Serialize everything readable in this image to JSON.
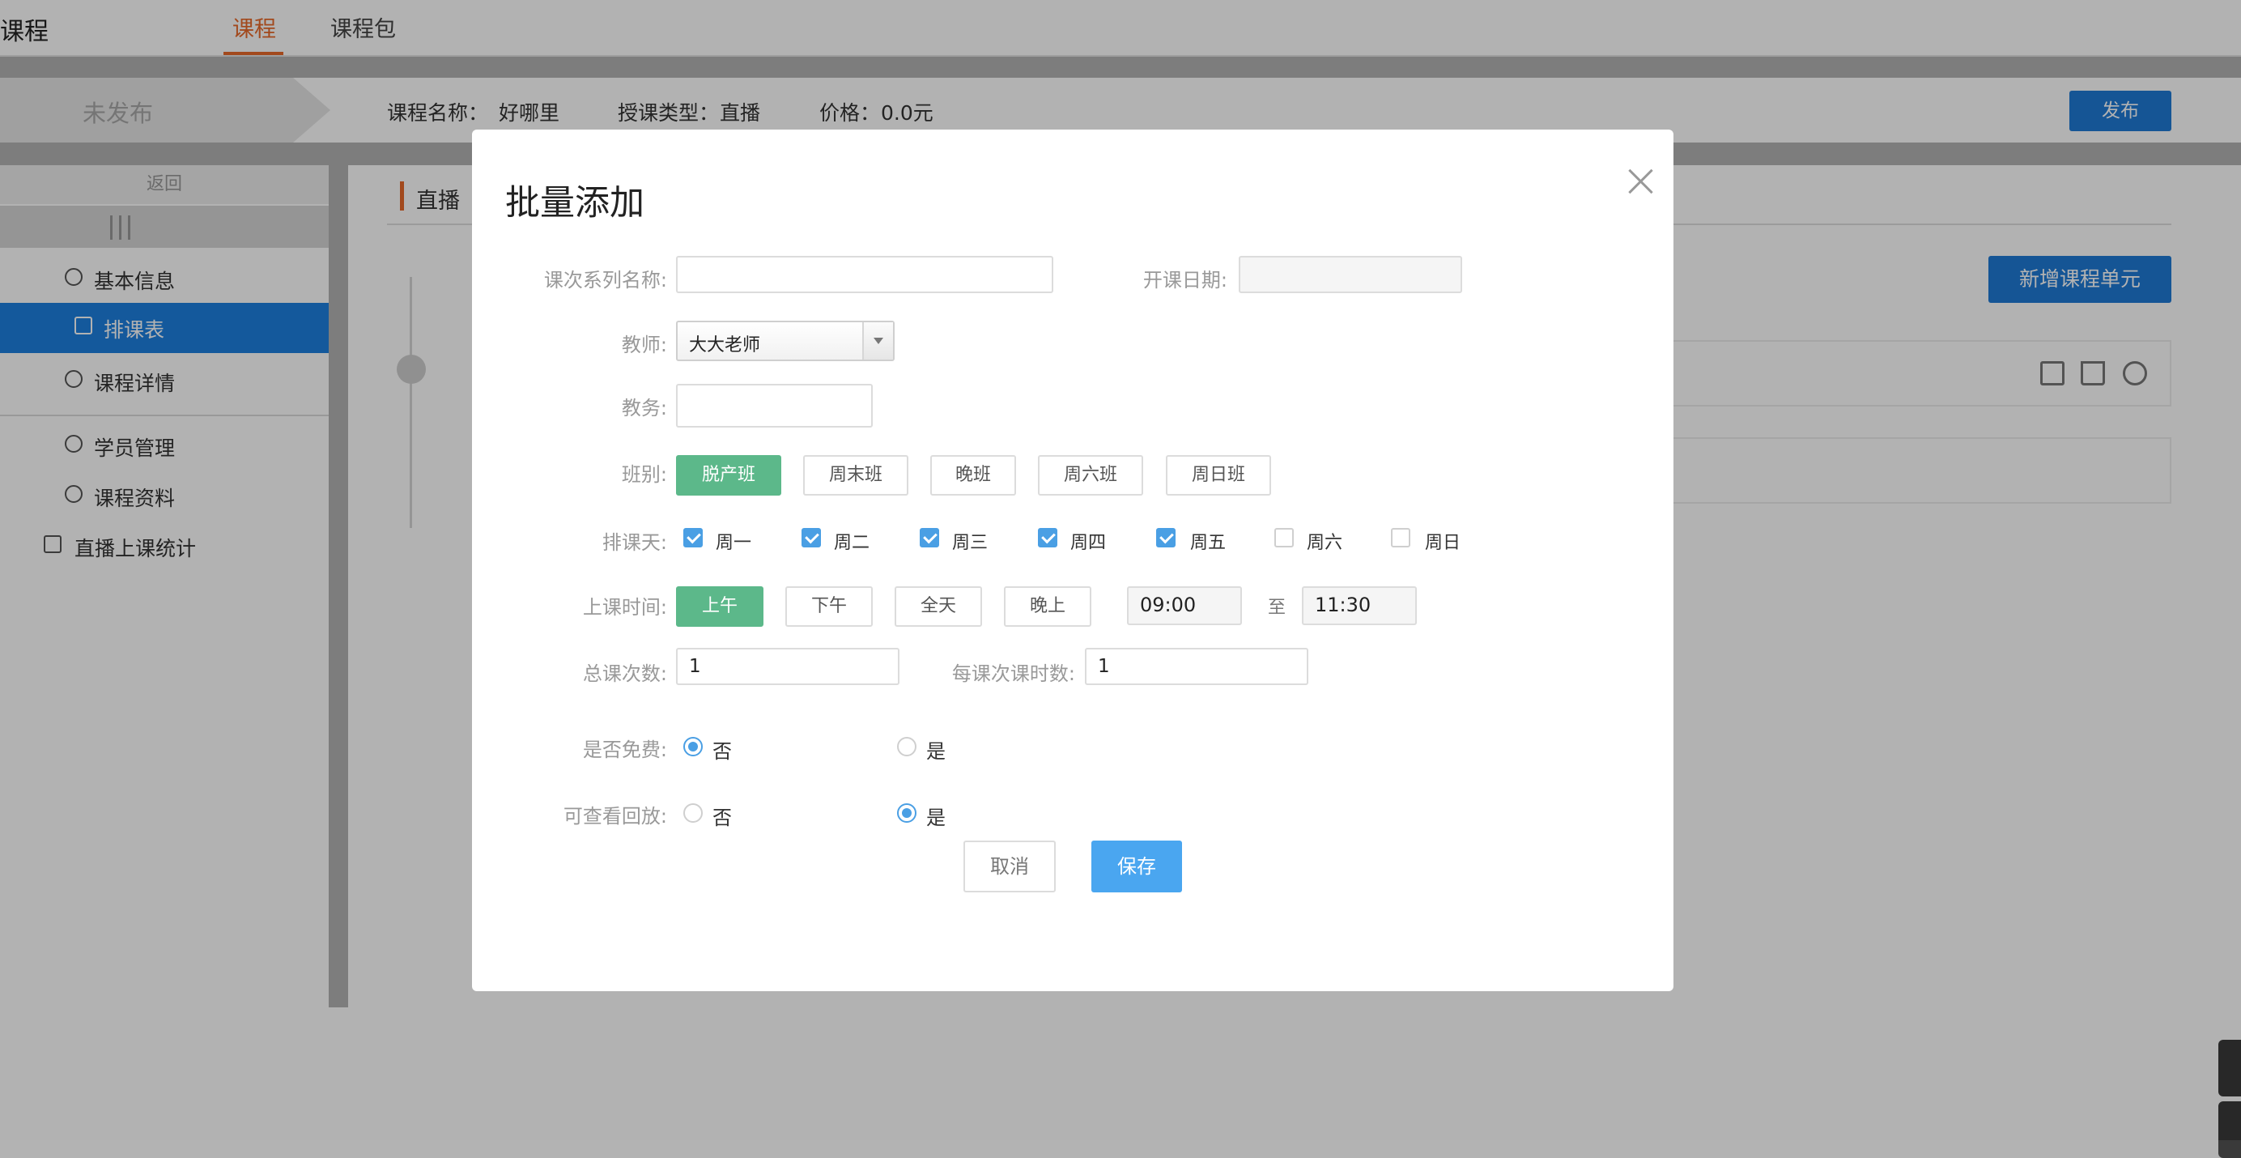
{
  "header": {
    "app_title": "课程",
    "tabs": [
      {
        "label": "课程"
      },
      {
        "label": "课程包"
      }
    ]
  },
  "course_info": {
    "status": "未发布",
    "name_label": "课程名称：",
    "name_value": "好哪里",
    "type_label": "授课类型：",
    "type_value": "直播",
    "price_label": "价格：",
    "price_value": "0.0元",
    "publish_label": "发布"
  },
  "sidebar": {
    "back_label": "返回",
    "items": [
      {
        "label": "基本信息",
        "icon": "list-circle-icon"
      },
      {
        "label": "排课表",
        "icon": "document-icon"
      },
      {
        "label": "课程详情",
        "icon": "detail-circle-icon"
      },
      {
        "label": "学员管理",
        "icon": "user-icon"
      },
      {
        "label": "课程资料",
        "icon": "pencil-circle-icon"
      },
      {
        "label": "直播上课统计",
        "icon": "calendar-icon"
      }
    ]
  },
  "main": {
    "section_title": "直播",
    "add_unit_label": "新增课程单元",
    "row_icons": [
      "edit-icon",
      "trash-icon",
      "more-icon"
    ]
  },
  "modal": {
    "title": "批量添加",
    "series_name": {
      "label": "课次系列名称:",
      "value": ""
    },
    "start_date": {
      "label": "开课日期:",
      "value": ""
    },
    "teacher": {
      "label": "教师:",
      "value": "大大老师"
    },
    "admin": {
      "label": "教务:",
      "value": ""
    },
    "class_type": {
      "label": "班别:",
      "options": [
        "脱产班",
        "周末班",
        "晚班",
        "周六班",
        "周日班"
      ],
      "selected": "脱产班"
    },
    "schedule_days": {
      "label": "排课天:",
      "days": [
        {
          "label": "周一",
          "checked": true
        },
        {
          "label": "周二",
          "checked": true
        },
        {
          "label": "周三",
          "checked": true
        },
        {
          "label": "周四",
          "checked": true
        },
        {
          "label": "周五",
          "checked": true
        },
        {
          "label": "周六",
          "checked": false
        },
        {
          "label": "周日",
          "checked": false
        }
      ]
    },
    "class_time": {
      "label": "上课时间:",
      "options": [
        "上午",
        "下午",
        "全天",
        "晚上"
      ],
      "selected": "上午",
      "start": "09:00",
      "to_label": "至",
      "end": "11:30"
    },
    "total_sessions": {
      "label": "总课次数:",
      "value": "1"
    },
    "hours_per_session": {
      "label": "每课次课时数:",
      "value": "1"
    },
    "is_free": {
      "label": "是否免费:",
      "options": [
        "否",
        "是"
      ],
      "selected": "否"
    },
    "replay": {
      "label": "可查看回放:",
      "options": [
        "否",
        "是"
      ],
      "selected": "是"
    },
    "cancel_label": "取消",
    "save_label": "保存"
  },
  "colors": {
    "accent_orange": "#e8692a",
    "primary_blue": "#1f7ad6",
    "active_green": "#5cb88a",
    "checkbox_blue": "#4a9fe4"
  }
}
